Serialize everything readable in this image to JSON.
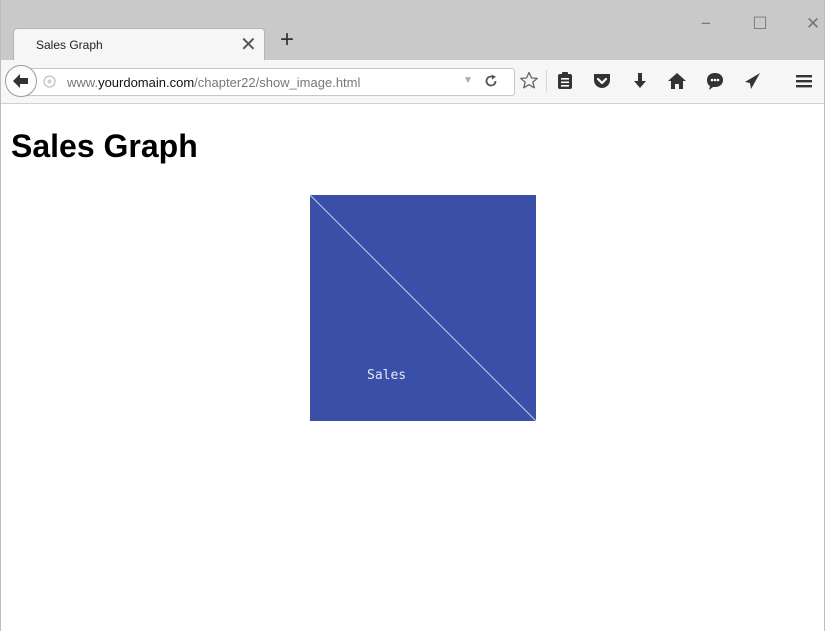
{
  "browser": {
    "tab": {
      "title": "Sales Graph"
    },
    "window_controls": {
      "minimize": "−",
      "maximize": "☐",
      "close": "✕"
    },
    "url": {
      "prefix": "www.",
      "domain": "yourdomain.com",
      "path": "/chapter22/show_image.html"
    },
    "toolbar_icons": [
      "star-icon",
      "reader-icon",
      "pocket-icon",
      "download-icon",
      "home-icon",
      "chat-icon",
      "send-icon",
      "menu-icon"
    ]
  },
  "page": {
    "heading": "Sales Graph",
    "image": {
      "label": "Sales",
      "background_color": "#3a50a8",
      "line_color": "#c8cbe0",
      "text_color": "#e6e8f3"
    }
  }
}
